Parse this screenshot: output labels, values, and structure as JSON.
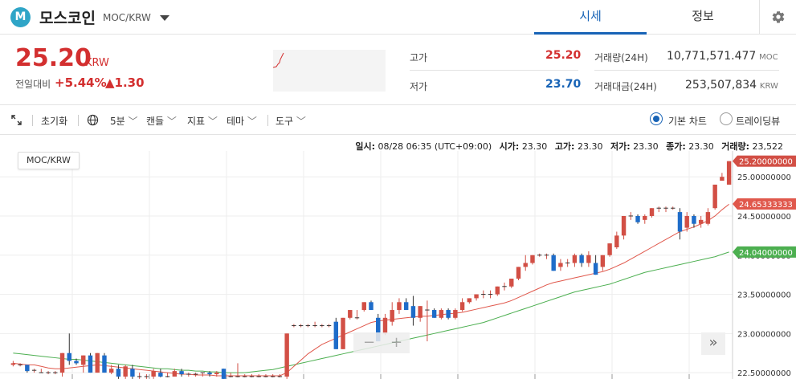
{
  "header": {
    "logo_letter": "M",
    "coin_name": "모스코인",
    "pair": "MOC/KRW",
    "tabs": [
      "시세",
      "정보"
    ]
  },
  "summary": {
    "price": "25.20",
    "price_unit": "KRW",
    "change_label": "전일대비",
    "change_rate": "+5.44%",
    "change_amount": "▲1.30",
    "high_label": "고가",
    "high_value": "25.20",
    "low_label": "저가",
    "low_value": "23.70",
    "volume_label": "거래량(24H)",
    "volume_value": "10,771,571.477",
    "volume_unit": "MOC",
    "amount_label": "거래대금(24H)",
    "amount_value": "253,507,834",
    "amount_unit": "KRW"
  },
  "toolbar": {
    "reset": "초기화",
    "interval": "5분",
    "candle": "캔들",
    "indicator": "지표",
    "theme": "테마",
    "tools": "도구",
    "basic_chart": "기본 차트",
    "tradingview": "트레이딩뷰"
  },
  "chart_info": {
    "time_label": "일시:",
    "time_value": "08/28 06:35 (UTC+09:00)",
    "open_label": "시가:",
    "open_value": "23.30",
    "high_label": "고가:",
    "high_value": "23.30",
    "low_label": "저가:",
    "low_value": "23.30",
    "close_label": "종가:",
    "close_value": "23.30",
    "volume_label": "거래량:",
    "volume_value": "23,522"
  },
  "chart_data": {
    "type": "candlestick",
    "pair": "MOC/KRW",
    "y_ticks": [
      "25.00000000",
      "24.50000000",
      "24.00000000",
      "23.50000000",
      "23.00000000",
      "22.50000000"
    ],
    "ylim": [
      22.46,
      25.33
    ],
    "price_labels": {
      "last": "25.20000000",
      "ma_short": "24.65333333",
      "ma_long": "24.04000000"
    },
    "candles": [
      [
        22.6,
        22.65,
        22.58,
        22.62
      ],
      [
        22.6,
        22.62,
        22.58,
        22.6
      ],
      [
        22.6,
        22.6,
        22.5,
        22.52
      ],
      [
        22.52,
        22.55,
        22.5,
        22.53
      ],
      [
        22.5,
        22.55,
        22.5,
        22.5
      ],
      [
        22.5,
        22.52,
        22.48,
        22.5
      ],
      [
        22.5,
        22.52,
        22.48,
        22.5
      ],
      [
        22.5,
        22.75,
        22.45,
        22.75
      ],
      [
        22.75,
        23.0,
        22.6,
        22.65
      ],
      [
        22.65,
        22.68,
        22.6,
        22.62
      ],
      [
        22.6,
        22.72,
        22.5,
        22.72
      ],
      [
        22.72,
        22.75,
        22.5,
        22.5
      ],
      [
        22.5,
        22.75,
        22.5,
        22.75
      ],
      [
        22.72,
        22.75,
        22.5,
        22.5
      ],
      [
        22.5,
        22.6,
        22.48,
        22.55
      ],
      [
        22.55,
        22.6,
        22.42,
        22.45
      ],
      [
        22.45,
        22.6,
        22.42,
        22.58
      ],
      [
        22.55,
        22.6,
        22.42,
        22.45
      ],
      [
        22.45,
        22.5,
        22.42,
        22.45
      ],
      [
        22.45,
        22.48,
        22.42,
        22.45
      ],
      [
        22.45,
        22.55,
        22.42,
        22.52
      ],
      [
        22.5,
        22.55,
        22.44,
        22.45
      ],
      [
        22.45,
        22.5,
        22.44,
        22.45
      ],
      [
        22.45,
        22.55,
        22.45,
        22.52
      ],
      [
        22.52,
        22.55,
        22.45,
        22.48
      ],
      [
        22.48,
        22.5,
        22.45,
        22.48
      ],
      [
        22.48,
        22.5,
        22.45,
        22.48
      ],
      [
        22.5,
        22.5,
        22.45,
        22.5
      ],
      [
        22.5,
        22.52,
        22.45,
        22.48
      ],
      [
        22.48,
        22.52,
        22.45,
        22.5
      ],
      [
        22.55,
        22.55,
        22.42,
        22.42
      ],
      [
        22.45,
        22.5,
        22.44,
        22.45
      ],
      [
        22.45,
        22.62,
        22.44,
        22.45
      ],
      [
        22.45,
        22.48,
        22.44,
        22.45
      ],
      [
        22.45,
        22.48,
        22.44,
        22.45
      ],
      [
        22.45,
        22.48,
        22.44,
        22.45
      ],
      [
        22.45,
        22.48,
        22.44,
        22.45
      ],
      [
        22.45,
        22.48,
        22.44,
        22.45
      ],
      [
        22.45,
        22.48,
        22.44,
        22.45
      ],
      [
        22.45,
        23.0,
        22.42,
        23.0
      ],
      [
        23.1,
        23.12,
        23.08,
        23.1
      ],
      [
        23.1,
        23.12,
        23.08,
        23.1
      ],
      [
        23.1,
        23.12,
        23.08,
        23.1
      ],
      [
        23.1,
        23.15,
        23.08,
        23.1
      ],
      [
        23.1,
        23.12,
        23.08,
        23.1
      ],
      [
        23.1,
        23.12,
        23.08,
        23.1
      ],
      [
        23.15,
        23.2,
        22.8,
        22.8
      ],
      [
        22.8,
        23.2,
        22.8,
        23.2
      ],
      [
        23.2,
        23.3,
        23.18,
        23.3
      ],
      [
        23.2,
        23.3,
        23.18,
        23.2
      ],
      [
        23.3,
        23.4,
        23.28,
        23.4
      ],
      [
        23.4,
        23.42,
        23.3,
        23.3
      ],
      [
        23.2,
        23.25,
        22.9,
        22.9
      ],
      [
        23.0,
        23.25,
        22.98,
        23.2
      ],
      [
        23.15,
        23.4,
        23.1,
        23.3
      ],
      [
        23.3,
        23.45,
        23.25,
        23.4
      ],
      [
        23.4,
        23.45,
        23.3,
        23.3
      ],
      [
        23.35,
        23.48,
        23.1,
        23.2
      ],
      [
        23.2,
        23.35,
        23.15,
        23.35
      ],
      [
        23.3,
        23.42,
        22.9,
        23.3
      ],
      [
        23.3,
        23.32,
        23.2,
        23.2
      ],
      [
        23.2,
        23.32,
        23.18,
        23.3
      ],
      [
        23.3,
        23.32,
        23.18,
        23.2
      ],
      [
        23.2,
        23.32,
        23.18,
        23.3
      ],
      [
        23.3,
        23.45,
        23.28,
        23.4
      ],
      [
        23.4,
        23.45,
        23.38,
        23.45
      ],
      [
        23.45,
        23.5,
        23.42,
        23.5
      ],
      [
        23.5,
        23.55,
        23.45,
        23.5
      ],
      [
        23.5,
        23.55,
        23.45,
        23.5
      ],
      [
        23.5,
        23.6,
        23.48,
        23.6
      ],
      [
        23.6,
        23.65,
        23.55,
        23.6
      ],
      [
        23.6,
        23.7,
        23.58,
        23.7
      ],
      [
        23.7,
        23.85,
        23.68,
        23.85
      ],
      [
        23.85,
        24.0,
        23.8,
        23.9
      ],
      [
        23.9,
        24.0,
        23.88,
        24.0
      ],
      [
        24.0,
        24.02,
        23.98,
        24.0
      ],
      [
        24.0,
        24.02,
        23.95,
        24.0
      ],
      [
        24.0,
        24.02,
        23.8,
        23.8
      ],
      [
        23.85,
        23.95,
        23.8,
        23.9
      ],
      [
        23.9,
        23.95,
        23.85,
        23.9
      ],
      [
        23.9,
        24.02,
        23.85,
        24.0
      ],
      [
        24.0,
        24.02,
        23.85,
        23.9
      ],
      [
        23.9,
        24.05,
        23.85,
        24.0
      ],
      [
        23.9,
        24.0,
        23.75,
        23.75
      ],
      [
        23.85,
        24.0,
        23.8,
        24.0
      ],
      [
        24.0,
        24.15,
        23.98,
        24.15
      ],
      [
        24.1,
        24.3,
        24.08,
        24.25
      ],
      [
        24.25,
        24.5,
        24.2,
        24.5
      ],
      [
        24.5,
        24.55,
        24.45,
        24.5
      ],
      [
        24.5,
        24.52,
        24.4,
        24.42
      ],
      [
        24.45,
        24.52,
        24.4,
        24.5
      ],
      [
        24.5,
        24.6,
        24.48,
        24.6
      ],
      [
        24.6,
        24.62,
        24.55,
        24.6
      ],
      [
        24.6,
        24.62,
        24.55,
        24.6
      ],
      [
        24.6,
        24.62,
        24.58,
        24.6
      ],
      [
        24.55,
        24.6,
        24.2,
        24.3
      ],
      [
        24.35,
        24.55,
        24.3,
        24.5
      ],
      [
        24.5,
        24.52,
        24.35,
        24.4
      ],
      [
        24.4,
        24.5,
        24.35,
        24.45
      ],
      [
        24.4,
        24.6,
        24.38,
        24.55
      ],
      [
        24.6,
        24.9,
        24.58,
        24.9
      ],
      [
        24.95,
        25.05,
        24.95,
        25.0
      ],
      [
        24.9,
        25.2,
        24.9,
        25.2
      ]
    ],
    "ma_short": [
      22.62,
      22.61,
      22.6,
      22.6,
      22.58,
      22.56,
      22.55,
      22.55,
      22.56,
      22.57,
      22.58,
      22.59,
      22.6,
      22.59,
      22.58,
      22.57,
      22.56,
      22.55,
      22.54,
      22.53,
      22.52,
      22.51,
      22.5,
      22.49,
      22.48,
      22.48,
      22.47,
      22.47,
      22.47,
      22.46,
      22.46,
      22.46,
      22.46,
      22.46,
      22.46,
      22.46,
      22.46,
      22.46,
      22.46,
      22.5,
      22.58,
      22.66,
      22.74,
      22.8,
      22.86,
      22.9,
      22.94,
      22.98,
      23.02,
      23.06,
      23.1,
      23.14,
      23.16,
      23.17,
      23.18,
      23.19,
      23.2,
      23.21,
      23.22,
      23.22,
      23.23,
      23.24,
      23.25,
      23.26,
      23.27,
      23.29,
      23.31,
      23.33,
      23.35,
      23.37,
      23.39,
      23.42,
      23.46,
      23.5,
      23.54,
      23.58,
      23.62,
      23.65,
      23.67,
      23.69,
      23.71,
      23.73,
      23.75,
      23.77,
      23.79,
      23.82,
      23.86,
      23.9,
      23.95,
      24.0,
      24.05,
      24.1,
      24.15,
      24.2,
      24.25,
      24.3,
      24.33,
      24.36,
      24.4,
      24.44,
      24.5,
      24.58,
      24.65
    ],
    "ma_long": [
      22.75,
      22.74,
      22.73,
      22.72,
      22.71,
      22.7,
      22.69,
      22.68,
      22.67,
      22.67,
      22.66,
      22.65,
      22.64,
      22.63,
      22.62,
      22.61,
      22.6,
      22.59,
      22.58,
      22.57,
      22.56,
      22.55,
      22.55,
      22.54,
      22.53,
      22.53,
      22.52,
      22.52,
      22.51,
      22.51,
      22.5,
      22.5,
      22.5,
      22.5,
      22.51,
      22.52,
      22.53,
      22.54,
      22.56,
      22.58,
      22.6,
      22.62,
      22.64,
      22.66,
      22.68,
      22.7,
      22.72,
      22.74,
      22.76,
      22.78,
      22.8,
      22.82,
      22.84,
      22.86,
      22.88,
      22.9,
      22.92,
      22.94,
      22.96,
      22.98,
      23.0,
      23.02,
      23.04,
      23.06,
      23.08,
      23.1,
      23.12,
      23.14,
      23.17,
      23.2,
      23.23,
      23.26,
      23.29,
      23.32,
      23.35,
      23.38,
      23.41,
      23.44,
      23.47,
      23.5,
      23.53,
      23.55,
      23.57,
      23.59,
      23.61,
      23.63,
      23.66,
      23.69,
      23.72,
      23.75,
      23.78,
      23.8,
      23.82,
      23.84,
      23.86,
      23.88,
      23.9,
      23.92,
      23.94,
      23.96,
      23.98,
      24.01,
      24.04
    ],
    "colors": {
      "up": "#d24f45",
      "down": "#1e6cc9",
      "ma_short": "#e0584c",
      "ma_long": "#4caf50"
    }
  }
}
